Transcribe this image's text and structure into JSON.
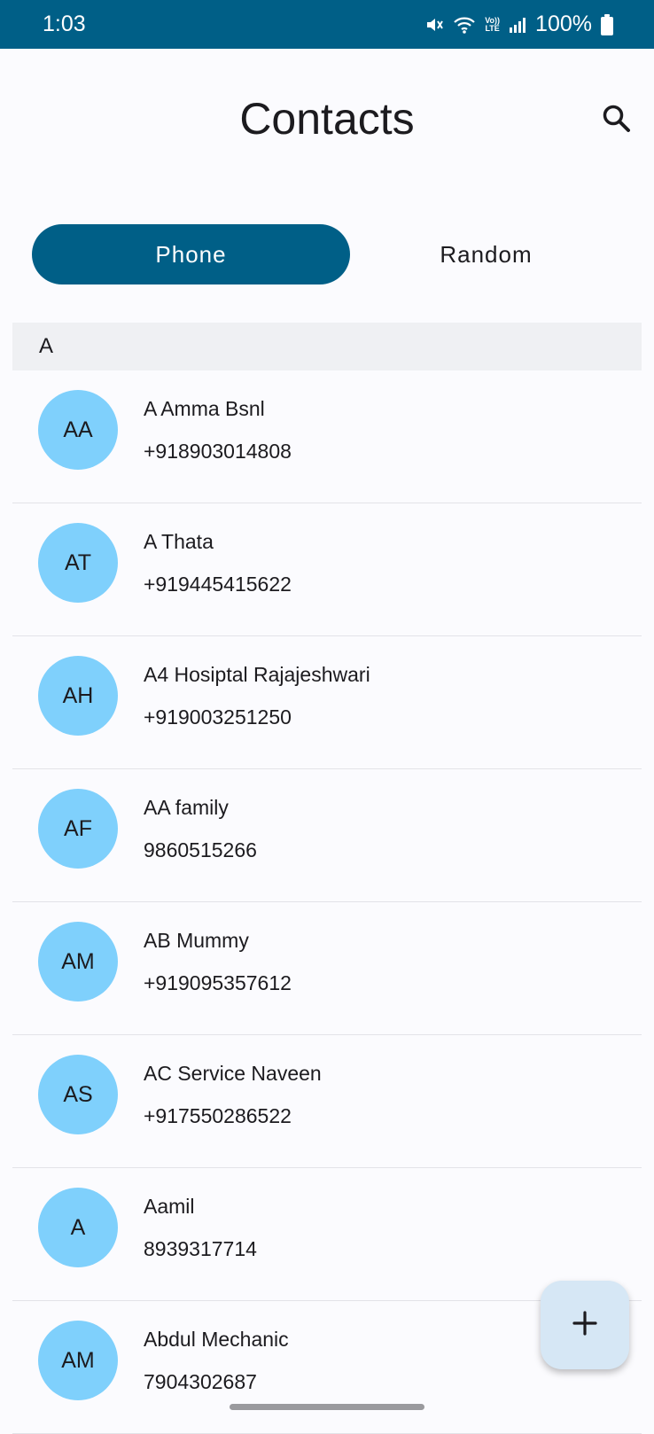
{
  "status_bar": {
    "time": "1:03",
    "battery": "100%",
    "icons": [
      "mute-icon",
      "wifi-icon",
      "volte-lte-icon",
      "signal-icon",
      "battery-icon"
    ],
    "volte_top": "Vo))",
    "volte_bottom": "LTE"
  },
  "header": {
    "title": "Contacts",
    "search_icon": "search-icon"
  },
  "tabs": [
    {
      "label": "Phone",
      "selected": true
    },
    {
      "label": "Random",
      "selected": false
    }
  ],
  "section": {
    "letter": "A"
  },
  "contacts": [
    {
      "initials": "AA",
      "name": "A Amma Bsnl",
      "phone": "+918903014808"
    },
    {
      "initials": "AT",
      "name": "A Thata",
      "phone": "+919445415622"
    },
    {
      "initials": "AH",
      "name": "A4 Hosiptal Rajajeshwari",
      "phone": "+919003251250"
    },
    {
      "initials": "AF",
      "name": "AA family",
      "phone": "9860515266"
    },
    {
      "initials": "AM",
      "name": "AB Mummy",
      "phone": "+919095357612"
    },
    {
      "initials": "AS",
      "name": "AC Service Naveen",
      "phone": "+917550286522"
    },
    {
      "initials": "A",
      "name": "Aamil",
      "phone": "8939317714"
    },
    {
      "initials": "AM",
      "name": "Abdul Mechanic",
      "phone": "7904302687"
    }
  ],
  "fab": {
    "icon": "plus-icon"
  },
  "colors": {
    "primary": "#005f87",
    "avatar": "#7fd0fc",
    "fab": "#d6e7f5",
    "section_bg": "#eff0f3",
    "background": "#fbfbfe"
  }
}
